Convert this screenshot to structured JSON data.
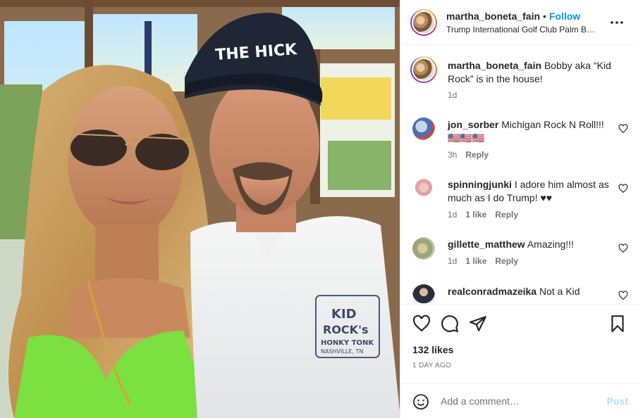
{
  "post": {
    "author": "martha_boneta_fain",
    "dot": "•",
    "follow_label": "Follow",
    "location": "Trump International Golf Club Palm B…",
    "caption": "Bobby aka “Kid Rock” is in the house!",
    "caption_time": "1d",
    "photo": {
      "hat_text": "THE HICK",
      "shirt_logo_line1": "KID",
      "shirt_logo_line2": "ROCK's",
      "shirt_logo_line3": "HONKY TONK",
      "shirt_logo_line4": "NASHVILLE, TN"
    }
  },
  "comments": [
    {
      "user": "jon_sorber",
      "text": "Michigan Rock N Roll!!! 🇺🇸🇺🇸🇺🇸",
      "time": "3h",
      "likes": "",
      "reply": "Reply"
    },
    {
      "user": "spinningjunki",
      "text": "I adore him almost as much as I do Trump! ♥♥",
      "time": "1d",
      "likes": "1 like",
      "reply": "Reply"
    },
    {
      "user": "gillette_matthew",
      "text": "Amazing!!!",
      "time": "1d",
      "likes": "1 like",
      "reply": "Reply"
    },
    {
      "user": "realconradmazeika",
      "text": "Not a Kid",
      "time": "",
      "likes": "",
      "reply": ""
    }
  ],
  "footer": {
    "likes": "132 likes",
    "ago": "1 DAY AGO",
    "comment_placeholder": "Add a comment…",
    "post_label": "Post"
  },
  "icons": {
    "more": "more-icon",
    "heart": "heart-icon",
    "comment": "comment-icon",
    "share": "share-icon",
    "save": "bookmark-icon",
    "emoji": "emoji-icon"
  },
  "colors": {
    "link": "#0095f6",
    "post_disabled": "#b3dbff",
    "muted": "#737373"
  }
}
